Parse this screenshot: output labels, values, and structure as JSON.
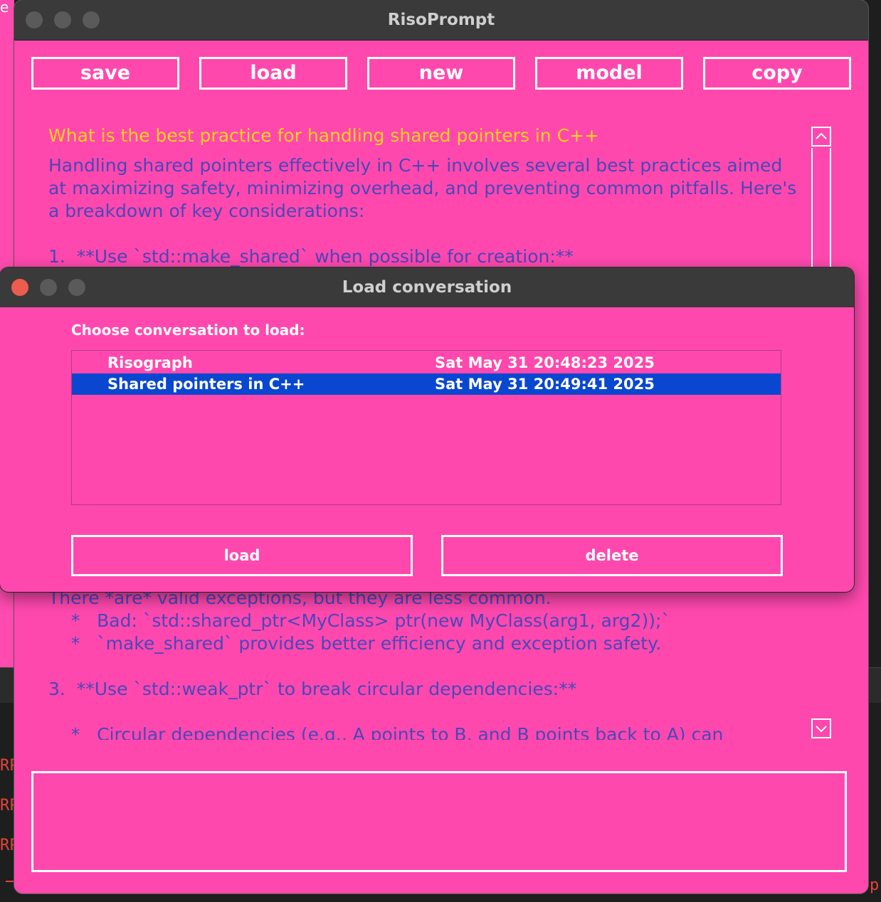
{
  "main_window": {
    "title": "RisoPrompt",
    "toolbar": {
      "save": "save",
      "load": "load",
      "new": "new",
      "model": "model",
      "copy": "copy"
    },
    "chat": {
      "question": "What is the best practice for handling shared pointers in C++",
      "top_lines": [
        "Handling shared pointers effectively in C++ involves several best practices aimed",
        "at maximizing safety, minimizing overhead, and preventing common pitfalls. Here's",
        "a breakdown of key considerations:",
        "",
        "1.  **Use `std::make_shared` when possible for creation:**"
      ],
      "bottom_lines": [
        "There *are* valid exceptions, but they are less common.",
        "    *   Bad: `std::shared_ptr<MyClass> ptr(new MyClass(arg1, arg2));`",
        "    *   `make_shared` provides better efficiency and exception safety.",
        "",
        "3.  **Use `std::weak_ptr` to break circular dependencies:**",
        "",
        "    *   Circular dependencies (e.g., A points to B, and B points back to A) can"
      ]
    },
    "input_placeholder": ""
  },
  "dialog": {
    "title": "Load conversation",
    "prompt": "Choose conversation to load:",
    "conversations": [
      {
        "name": "Risograph",
        "date": "Sat May 31 20:48:23 2025"
      },
      {
        "name": "Shared pointers in C++",
        "date": "Sat May 31 20:49:41 2025"
      }
    ],
    "load_button": "load",
    "delete_button": "delete"
  },
  "background": {
    "tab_fragment": "e",
    "rp_fragment": "RP",
    "p_fragment": "p"
  },
  "colors": {
    "accent_pink": "#ff48ae",
    "question_yellow": "#ffd21a",
    "answer_blue": "#4a47b8",
    "selection_blue": "#0a47d0",
    "close_red": "#ee5b4f"
  }
}
